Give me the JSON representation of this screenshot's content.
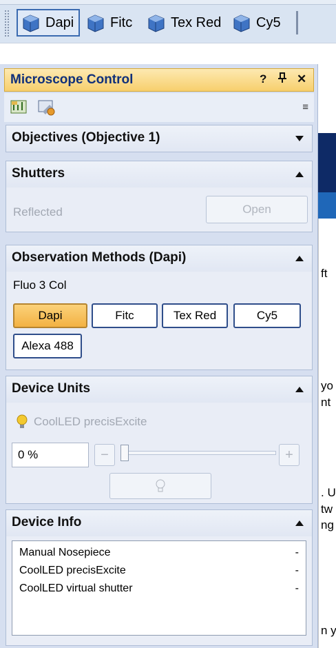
{
  "toolbar": {
    "buttons": [
      {
        "label": "Dapi",
        "selected": true
      },
      {
        "label": "Fitc",
        "selected": false
      },
      {
        "label": "Tex Red",
        "selected": false
      },
      {
        "label": "Cy5",
        "selected": false
      }
    ]
  },
  "panel": {
    "title": "Microscope Control",
    "controls": {
      "help": "?",
      "pin": "↕",
      "close": "✕"
    },
    "iconbar": {
      "icons": [
        "microscope-settings-icon",
        "configure-icon"
      ],
      "overflow": "≡"
    }
  },
  "objectives": {
    "header": "Objectives (Objective 1)",
    "collapsed": true
  },
  "shutters": {
    "header": "Shutters",
    "label": "Reflected",
    "button": "Open"
  },
  "observation": {
    "header": "Observation Methods (Dapi)",
    "group": "Fluo 3 Col",
    "methods": [
      "Dapi",
      "Fitc",
      "Tex Red",
      "Cy5",
      "Alexa 488"
    ],
    "active": "Dapi"
  },
  "device_units": {
    "header": "Device Units",
    "device": "CoolLED precisExcite",
    "intensity_text": "0 %",
    "intensity_value": 0,
    "minus": "−",
    "plus": "+"
  },
  "device_info": {
    "header": "Device Info",
    "rows": [
      {
        "name": "Manual Nosepiece",
        "value": "-"
      },
      {
        "name": "CoolLED precisExcite",
        "value": "-"
      },
      {
        "name": "CoolLED virtual shutter",
        "value": "-"
      }
    ]
  },
  "background_fragments": [
    "ft",
    "yo",
    "nt",
    ". U",
    "tw",
    "ng",
    "n y"
  ],
  "colors": {
    "active": "#f3b243",
    "title": "#10307a",
    "panel": "#d6dff0"
  }
}
